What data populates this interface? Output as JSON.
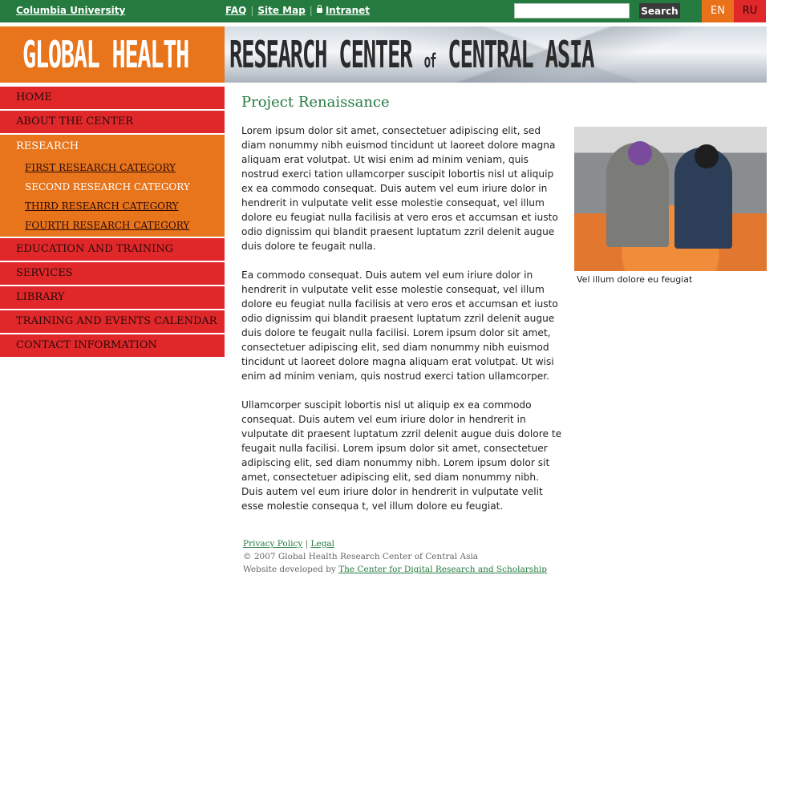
{
  "topbar": {
    "university_link": "Columbia University",
    "links": [
      "FAQ",
      "Site Map",
      "Intranet"
    ],
    "search": {
      "placeholder": "",
      "button_label": "Search"
    },
    "languages": [
      "EN",
      "RU"
    ]
  },
  "banner": {
    "part1": "GLOBAL HEALTH",
    "part2": "RESEARCH CENTER",
    "of": "of",
    "part3": "CENTRAL ASIA"
  },
  "nav": {
    "home": "HOME",
    "about": "ABOUT THE CENTER",
    "research": "RESEARCH",
    "research_sub": [
      "First Research Category",
      "Second Research Category",
      "Third Research Category",
      "Fourth Research Category"
    ],
    "education": "EDUCATION AND TRAINING",
    "services": "SERVICES",
    "library": "LIBRARY",
    "calendar": "TRAINING AND EVENTS CALENDAR",
    "contact": "CONTACT INFORMATION"
  },
  "main": {
    "title": "Project Renaissance",
    "paragraphs": [
      "Lorem ipsum dolor sit amet, consectetuer adipiscing elit, sed diam nonummy nibh euismod tincidunt ut laoreet dolore magna aliquam erat volutpat. Ut wisi enim ad minim veniam, quis nostrud exerci tation ullamcorper suscipit lobortis nisl ut aliquip ex ea commodo consequat. Duis autem vel eum iriure dolor in hendrerit in vulputate velit esse molestie consequat, vel illum dolore eu feugiat nulla facilisis at vero eros et accumsan et iusto odio dignissim qui blandit praesent luptatum zzril delenit augue duis dolore te feugait nulla.",
      "Ea commodo consequat. Duis autem vel eum iriure dolor in hendrerit in vulputate velit esse molestie consequat, vel illum dolore eu feugiat nulla facilisis at vero eros et accumsan et iusto odio dignissim qui blandit praesent luptatum zzril delenit augue duis dolore te feugait nulla facilisi. Lorem ipsum dolor sit amet, consectetuer adipiscing elit, sed diam nonummy nibh euismod tincidunt ut laoreet dolore magna aliquam erat volutpat. Ut wisi enim ad minim veniam, quis nostrud exerci tation ullamcorper.",
      "Ullamcorper suscipit lobortis nisl ut aliquip ex ea commodo consequat. Duis autem vel eum iriure dolor in hendrerit in vulputate dit praesent luptatum zzril delenit augue duis dolore te feugait nulla facilisi. Lorem ipsum dolor sit amet, consectetuer adipiscing elit, sed diam nonummy nibh. Lorem ipsum dolor sit amet, consectetuer adipiscing elit, sed diam nonummy nibh. Duis autem vel eum iriure dolor in hendrerit in vulputate velit esse molestie consequa t, vel illum dolore eu feugiat."
    ],
    "photo_caption": "Vel illum dolore eu feugiat"
  },
  "footer": {
    "privacy": "Privacy Policy",
    "separator": "|",
    "legal": "Legal",
    "copyright": "© 2007 Global Health Research Center of Central Asia",
    "developed_by": "Website developed by",
    "developer_link": "The Center for Digital Research and Scholarship"
  }
}
